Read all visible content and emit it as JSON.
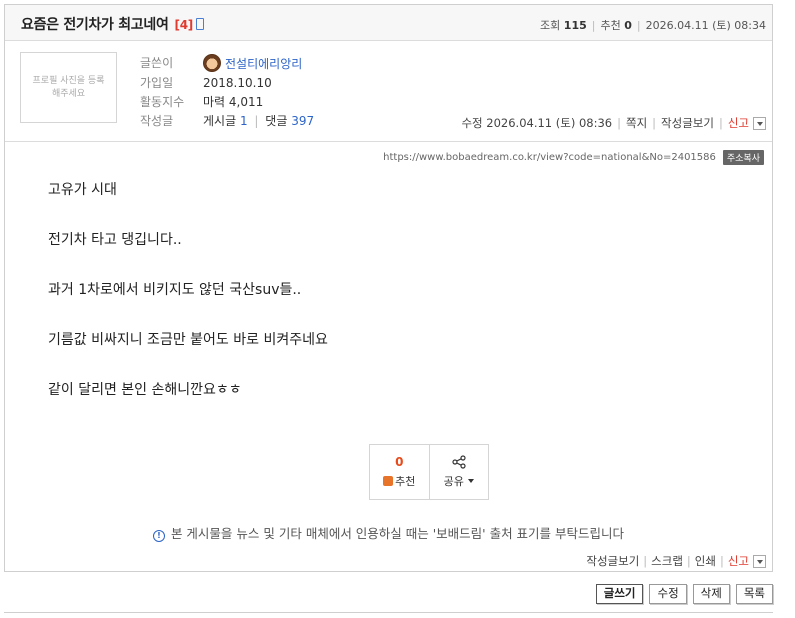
{
  "post": {
    "title": "요즘은 전기차가 최고네여",
    "comment_count": "[4]",
    "stats": {
      "views_label": "조회",
      "views": "115",
      "recommend_label": "추천",
      "recommend": "0",
      "date": "2026.04.11 (토) 08:34"
    }
  },
  "author": {
    "photo_placeholder": "프로필 사진을 등록해주세요",
    "writer_label": "글쓴이",
    "nickname": "전설티에리앙리",
    "joined_label": "가입일",
    "joined": "2018.10.10",
    "activity_label": "활동지수",
    "activity": "마력 4,011",
    "posts_label": "작성글",
    "post_count_label": "게시글",
    "post_count": "1",
    "reply_count_label": "댓글",
    "reply_count": "397"
  },
  "meta": {
    "edited": "수정 2026.04.11 (토) 08:36",
    "message": "쪽지",
    "view_posts": "작성글보기",
    "report": "신고"
  },
  "url": {
    "text": "https://www.bobaedream.co.kr/view?code=national&No=2401586",
    "copy_button": "주소복사"
  },
  "content": {
    "lines": [
      "고유가 시대",
      "전기차 타고 댕깁니다..",
      "과거 1차로에서 비키지도 않던 국산suv들..",
      "기름값 비싸지니 조금만 붙어도 바로 비켜주네요",
      "같이 달리면 본인 손해니깐요ㅎㅎ"
    ]
  },
  "vote": {
    "count": "0",
    "recommend_label": "추천",
    "share_label": "공유"
  },
  "notice": "본 게시물을 뉴스 및 기타 매체에서 인용하실 때는 '보배드림' 출처 표기를 부탁드립니다",
  "bottom_links": {
    "view_posts": "작성글보기",
    "scrap": "스크랩",
    "print": "인쇄",
    "report": "신고"
  },
  "actions": {
    "write": "글쓰기",
    "edit": "수정",
    "delete": "삭제",
    "list": "목록"
  },
  "colors": {
    "accent_red": "#e03a2e",
    "link_blue": "#2d64c8",
    "vote_orange": "#e84a1a"
  }
}
